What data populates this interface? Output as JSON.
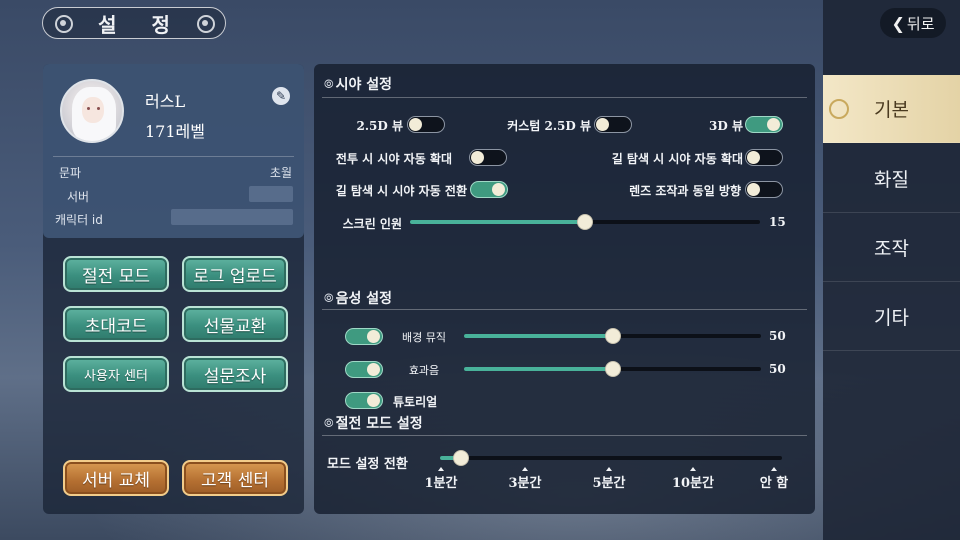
{
  "title": "설 정",
  "back_label": "뒤로",
  "sidebar": {
    "tabs": [
      {
        "label": "기본"
      },
      {
        "label": "화질"
      },
      {
        "label": "조작"
      },
      {
        "label": "기타"
      }
    ],
    "active_index": 0
  },
  "profile": {
    "name": "러스L",
    "level": "171레벨",
    "faction_label": "문파",
    "faction_value": "초월",
    "server_label": "서버",
    "character_id_label": "캐릭터 id"
  },
  "left_buttons": {
    "closed_mode": "절전 모드",
    "log_upload": "로그 업로드",
    "invite_code": "초대코드",
    "gift_exchange": "선물교환",
    "user_center": "사용자 센터",
    "survey": "설문조사",
    "switch_server": "서버 교체",
    "customer_center": "고객 센터"
  },
  "view_settings": {
    "title": "시야 설정",
    "view_25d": {
      "label": "2.5D 뷰",
      "on": false
    },
    "custom_25d": {
      "label": "커스텀 2.5D 뷰",
      "on": false
    },
    "view_3d": {
      "label": "3D 뷰",
      "on": true
    },
    "combat_auto_zoom": {
      "label": "전투 시 시야 자동 확대",
      "on": false
    },
    "path_auto_zoom": {
      "label": "길 탐색 시 시야 자동 확대",
      "on": false
    },
    "path_auto_switch": {
      "label": "길 탐색 시 시야 자동 전환",
      "on": true
    },
    "lens_same_direction": {
      "label": "렌즈 조작과 동일 방향",
      "on": false
    },
    "screen_people": {
      "label": "스크린 인원",
      "value": 15,
      "fraction": 0.5
    }
  },
  "audio_settings": {
    "title": "음성 설정",
    "bgm": {
      "label": "배경 뮤직",
      "on": true,
      "value": 50,
      "fraction": 0.5
    },
    "sfx": {
      "label": "효과음",
      "on": true,
      "value": 50,
      "fraction": 0.5
    },
    "tutorial": {
      "label": "튜토리얼",
      "on": true
    }
  },
  "power_save": {
    "title": "절전 모드 설정",
    "switch_label": "모드 설정 전환",
    "options": [
      "1분간",
      "3분간",
      "5분간",
      "10분간",
      "안 함"
    ],
    "selected_index": 1
  },
  "colors": {
    "accent_green": "#49b29a",
    "tab_active": "#f3e7c7",
    "amber": "#c4803f"
  }
}
